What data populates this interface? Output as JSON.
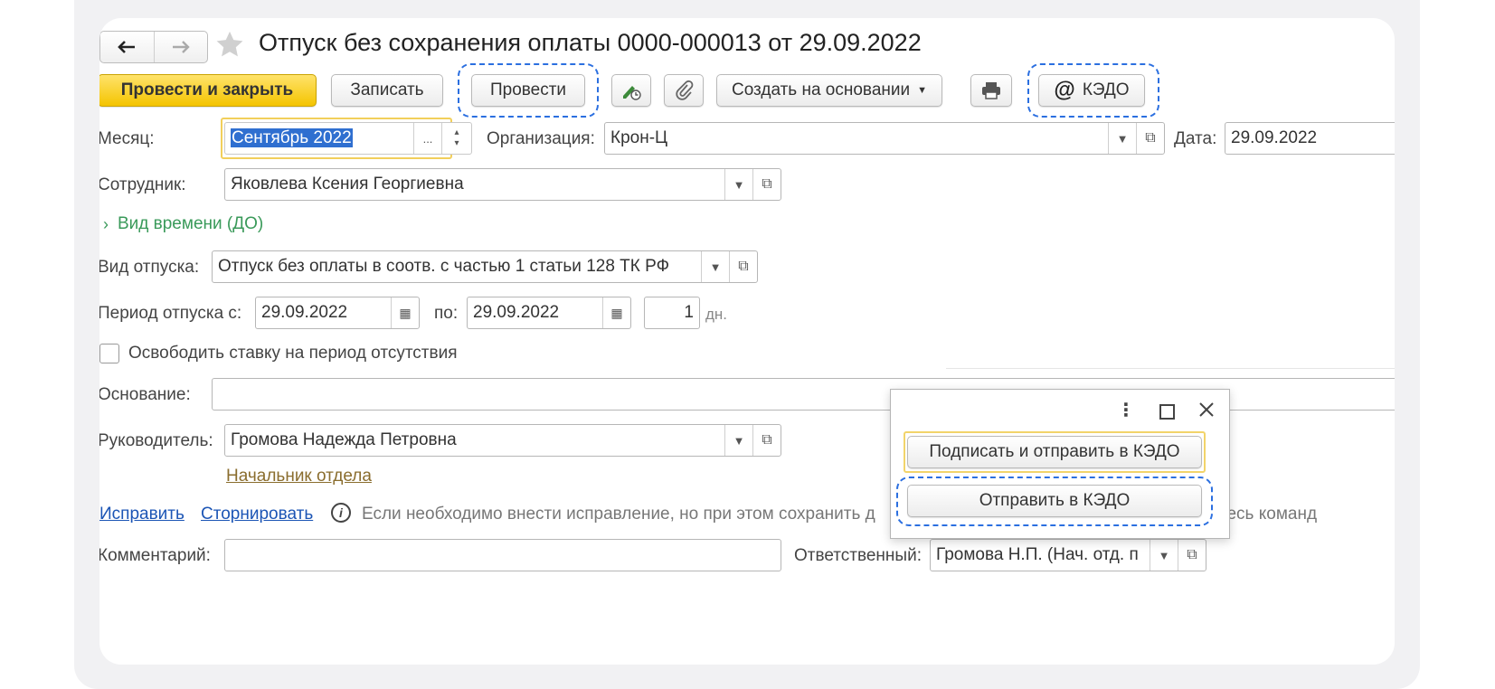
{
  "nav": {
    "back_icon": "arrow-left-icon",
    "forward_icon": "arrow-right-icon",
    "favorite_icon": "star-icon"
  },
  "title": "Отпуск без сохранения оплаты 0000-000013 от 29.09.2022",
  "toolbar": {
    "post_close": "Провести и закрыть",
    "save": "Записать",
    "post": "Провести",
    "create_based_on": "Создать на основании",
    "kedo": "КЭДО",
    "kedo_icon": "at-sign-icon"
  },
  "fields": {
    "month_label": "Месяц:",
    "month_value": "Сентябрь 2022",
    "org_label": "Организация:",
    "org_value": "Крон-Ц",
    "date_label": "Дата:",
    "date_value": "29.09.2022",
    "employee_label": "Сотрудник:",
    "employee_value": "Яковлева Ксения Георгиевна",
    "time_type_label": "Вид времени (ДО)",
    "leave_type_label": "Вид отпуска:",
    "leave_type_value": "Отпуск без оплаты в соотв. с частью 1 статьи 128 ТК РФ",
    "period_label": "Период отпуска с:",
    "period_from": "29.09.2022",
    "period_to_label": "по:",
    "period_to": "29.09.2022",
    "days_value": "1",
    "days_unit": "дн.",
    "release_rate_label": "Освободить ставку на период отсутствия",
    "basis_label": "Основание:",
    "basis_value": "",
    "manager_label": "Руководитель:",
    "manager_value": "Громова Надежда Петровна",
    "manager_position": "Начальник отдела",
    "comment_label": "Комментарий:",
    "comment_value": "",
    "responsible_label": "Ответственный:",
    "responsible_value": "Громова Н.П. (Нач. отд. п"
  },
  "actions": {
    "fix": "Исправить",
    "reverse": "Сторнировать",
    "info_text": "Если необходимо внести исправление, но при этом сохранить д",
    "info_tail": "тесь команд"
  },
  "popup": {
    "sign_send": "Подписать и отправить в КЭДО",
    "send": "Отправить в КЭДО"
  },
  "colors": {
    "accent_dash": "#2b6fe0",
    "primary_button": "#f4c400",
    "link": "#1c55b5",
    "green_group": "#3a9a5a"
  }
}
